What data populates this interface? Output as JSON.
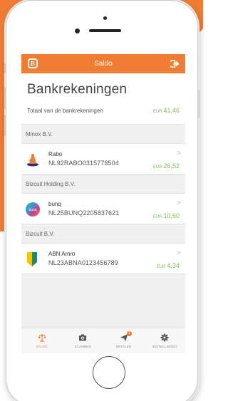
{
  "colors": {
    "accent": "#f07c33",
    "amount_green": "#7cc04b",
    "background_orange": "#f07c33"
  },
  "header": {
    "title": "Saldo",
    "logo_icon": "bizcuit-logo-icon",
    "logo_letter": "B",
    "logout_icon": "logout-icon"
  },
  "summary": {
    "heading": "Bankrekeningen",
    "total_label": "Totaal van de bankrekeningen",
    "currency": "EUR",
    "total_amount": "41,46"
  },
  "groups": [
    {
      "name": "Minox B.V.",
      "account": {
        "bank": "Rabo",
        "iban": "NL92RABO0315778504",
        "currency": "EUR",
        "amount": "26,52",
        "logo_icon": "rabobank-logo-icon"
      }
    },
    {
      "name": "Bizcuit Holding B.V.",
      "account": {
        "bank": "bunq",
        "iban": "NL25BUNQ2205837621",
        "currency": "EUR",
        "amount": "10,60",
        "logo_icon": "bunq-logo-icon",
        "logo_text": "bunq"
      }
    },
    {
      "name": "Bizcuit B.V.",
      "account": {
        "bank": "ABN Amro",
        "iban": "NL23ABNA0123456789",
        "currency": "EUR",
        "amount": "4,34",
        "logo_icon": "abn-amro-logo-icon"
      }
    }
  ],
  "chevron": ">",
  "tabs": [
    {
      "label": "SALDO",
      "icon": "scale-icon",
      "active": true
    },
    {
      "label": "SCANNEN",
      "icon": "camera-icon",
      "active": false
    },
    {
      "label": "BETALEN",
      "icon": "send-icon",
      "active": false,
      "badge": "1"
    },
    {
      "label": "INSTELLINGEN",
      "icon": "gear-icon",
      "active": false
    }
  ]
}
